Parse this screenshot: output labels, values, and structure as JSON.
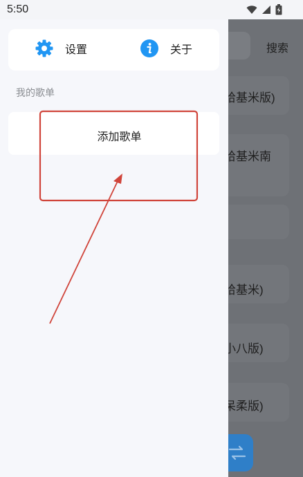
{
  "status_bar": {
    "time": "5:50"
  },
  "drawer": {
    "settings_label": "设置",
    "about_label": "关于",
    "section_title": "我的歌单",
    "add_playlist_label": "添加歌单"
  },
  "background": {
    "search_label": "搜索",
    "rows": [
      "哈基米版)",
      "哈基米南",
      "哈基米)",
      "小八版)",
      "呆柔版)"
    ]
  },
  "colors": {
    "accent_blue": "#2196f3",
    "annotation_red": "#d0443a"
  }
}
